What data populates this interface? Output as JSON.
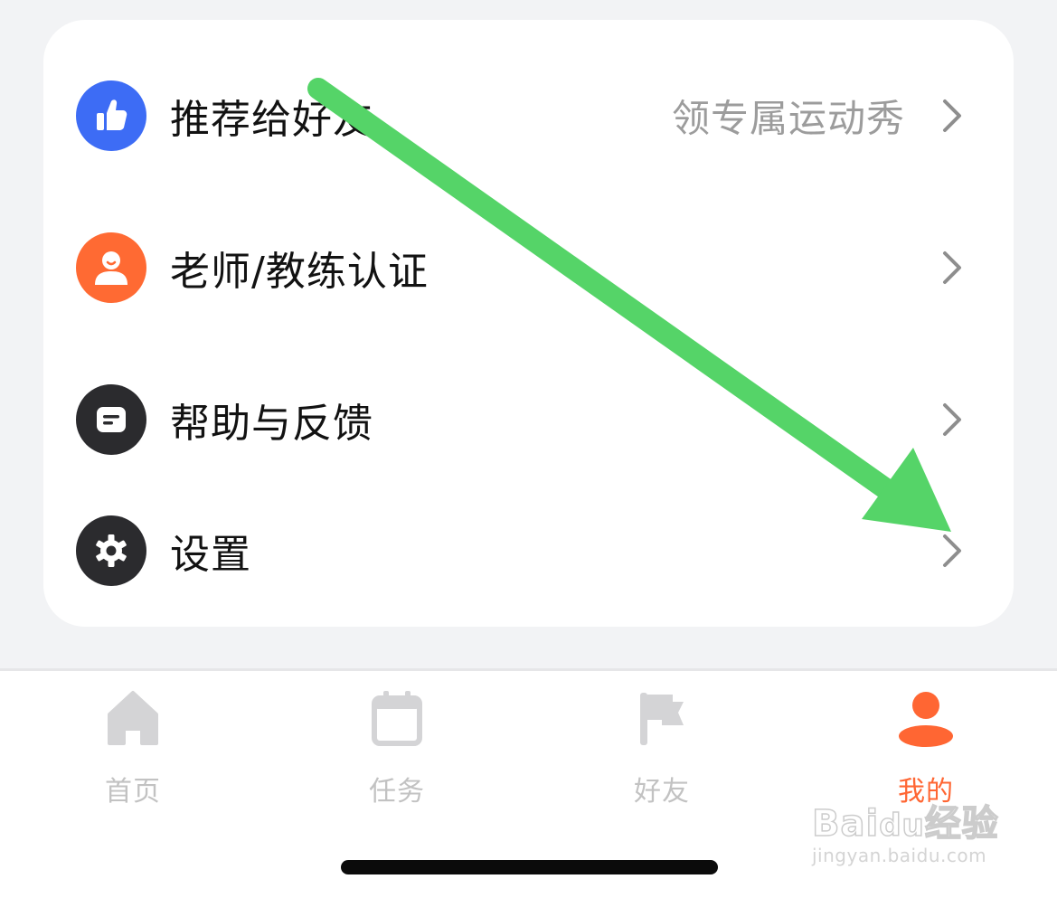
{
  "menu": {
    "items": [
      {
        "label": "推荐给好友",
        "hint": "领专属运动秀",
        "icon": "thumbs-up-icon",
        "icon_color": "#3d6cf5"
      },
      {
        "label": "老师/教练认证",
        "hint": "",
        "icon": "person-icon",
        "icon_color": "#ff6a33"
      },
      {
        "label": "帮助与反馈",
        "hint": "",
        "icon": "message-icon",
        "icon_color": "#2b2b2e"
      },
      {
        "label": "设置",
        "hint": "",
        "icon": "gear-icon",
        "icon_color": "#2b2b2e"
      }
    ]
  },
  "tabbar": {
    "tabs": [
      {
        "label": "首页",
        "icon": "home-icon",
        "active": false
      },
      {
        "label": "任务",
        "icon": "calendar-icon",
        "active": false
      },
      {
        "label": "好友",
        "icon": "flag-icon",
        "active": false
      },
      {
        "label": "我的",
        "icon": "profile-icon",
        "active": true
      }
    ],
    "active_color": "#ff6633",
    "inactive_color": "#c2c2c2"
  },
  "annotation": {
    "type": "arrow",
    "color": "#55d468",
    "points_to": "设置"
  },
  "watermark": {
    "logo": "Baidu经验",
    "url": "jingyan.baidu.com"
  }
}
